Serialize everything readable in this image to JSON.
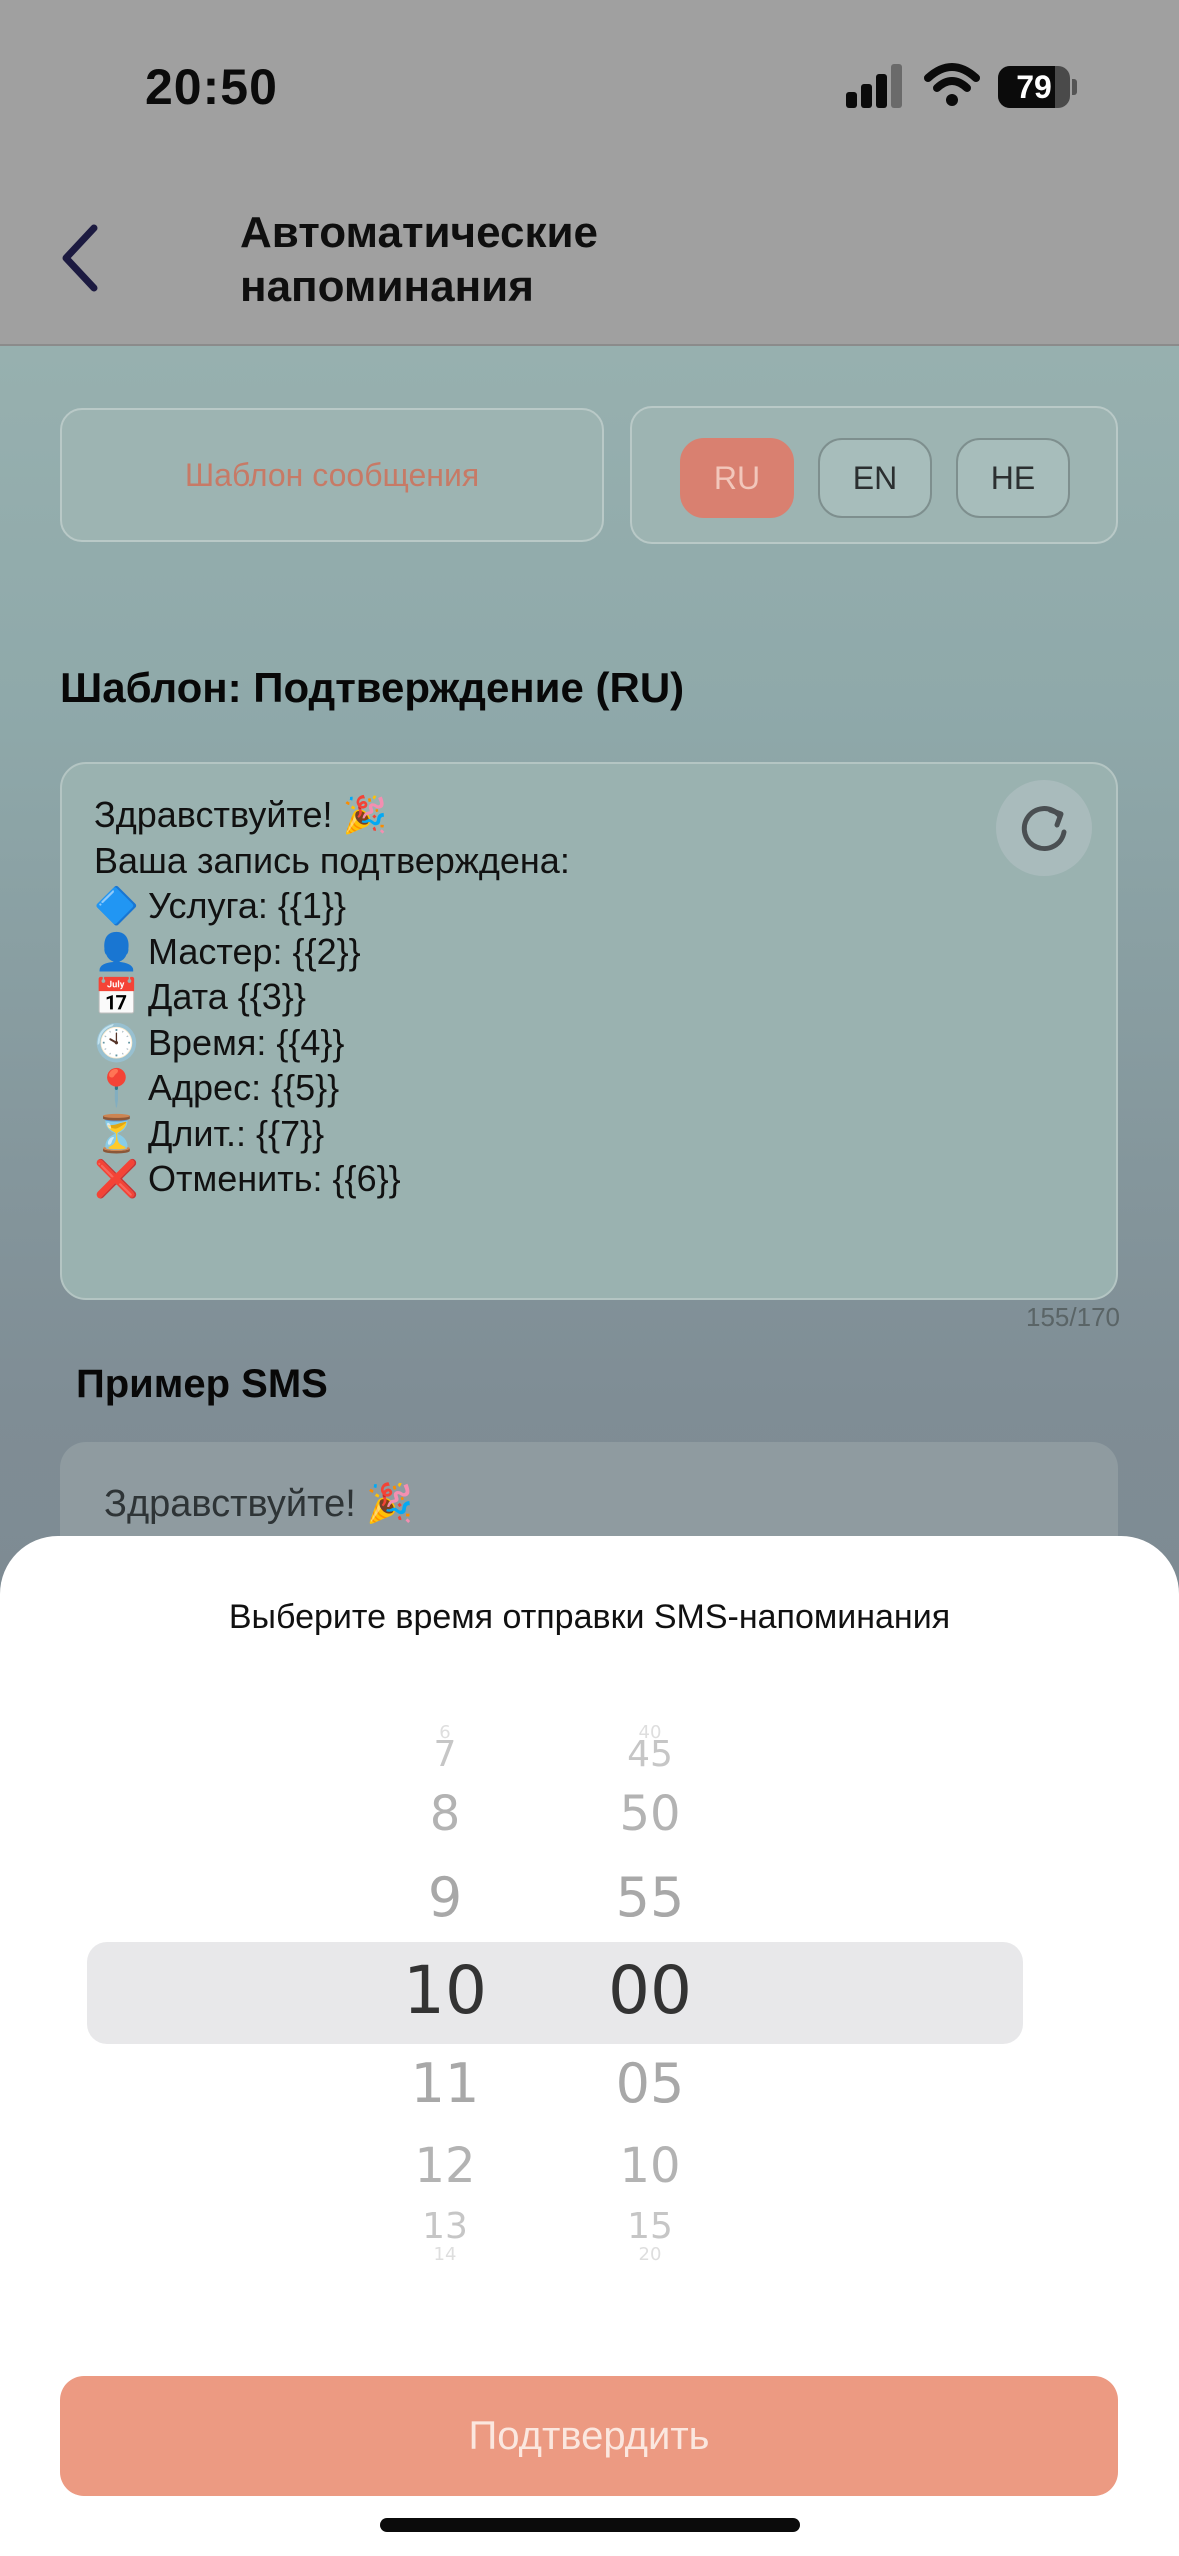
{
  "status_bar": {
    "time": "20:50",
    "battery": "79",
    "battery_level": 0.79
  },
  "header": {
    "title_line1": "Автоматические",
    "title_line2": "напоминания",
    "back_icon": "chevron-left-icon"
  },
  "controls": {
    "template_button": "Шаблон сообщения",
    "languages": [
      {
        "label": "RU",
        "active": true
      },
      {
        "label": "EN",
        "active": false
      },
      {
        "label": "HE",
        "active": false
      }
    ]
  },
  "template": {
    "title": "Шаблон: Подтверждение (RU)",
    "lines": [
      {
        "emoji": "",
        "text": "Здравствуйте! 🎉"
      },
      {
        "emoji": "",
        "text": "Ваша запись подтверждена:"
      },
      {
        "emoji": "🔷",
        "text": "Услуга: {{1}}"
      },
      {
        "emoji": "👤",
        "text": "Мастер: {{2}}"
      },
      {
        "emoji": "📅",
        "text": "Дата {{3}}"
      },
      {
        "emoji": "🕙",
        "text": "Время: {{4}}"
      },
      {
        "emoji": "📍",
        "text": "Адрес: {{5}}"
      },
      {
        "emoji": "⏳",
        "text": "Длит.: {{7}}"
      },
      {
        "emoji": "❌",
        "text": "Отменить: {{6}}"
      }
    ],
    "counter": "155/170",
    "refresh_icon": "refresh-icon"
  },
  "sample": {
    "title": "Пример SMS",
    "text": "Здравствуйте! 🎉"
  },
  "sheet": {
    "title": "Выберите время отправки SMS-напоминания",
    "hours": [
      "6",
      "7",
      "8",
      "9",
      "10",
      "11",
      "12",
      "13",
      "14"
    ],
    "minutes": [
      "40",
      "45",
      "50",
      "55",
      "00",
      "05",
      "10",
      "15",
      "20"
    ],
    "selected_hour": "10",
    "selected_minute": "00",
    "confirm": "Подтвердить"
  }
}
